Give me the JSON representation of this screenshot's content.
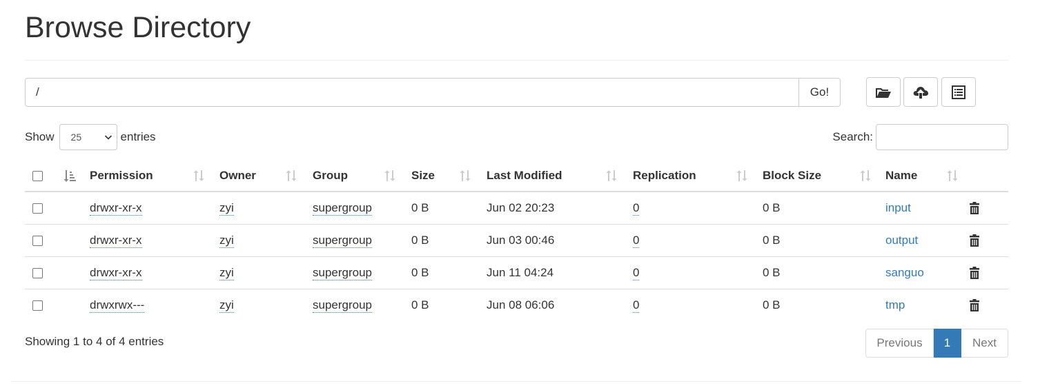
{
  "page": {
    "title": "Browse Directory"
  },
  "path_bar": {
    "value": "/",
    "go_label": "Go!"
  },
  "toolbar": {
    "buttons": [
      {
        "name": "create-directory",
        "icon": "folder-open-icon"
      },
      {
        "name": "upload",
        "icon": "cloud-upload-icon"
      },
      {
        "name": "cut-paste",
        "icon": "list-alt-icon"
      }
    ]
  },
  "length_control": {
    "show_label": "Show",
    "selected": "25",
    "entries_label": "entries"
  },
  "search": {
    "label": "Search:",
    "value": ""
  },
  "table": {
    "columns": [
      "Permission",
      "Owner",
      "Group",
      "Size",
      "Last Modified",
      "Replication",
      "Block Size",
      "Name"
    ],
    "rows": [
      {
        "permission": "drwxr-xr-x",
        "owner": "zyi",
        "group": "supergroup",
        "size": "0 B",
        "modified": "Jun 02 20:23",
        "replication": "0",
        "block_size": "0 B",
        "name": "input"
      },
      {
        "permission": "drwxr-xr-x",
        "owner": "zyi",
        "group": "supergroup",
        "size": "0 B",
        "modified": "Jun 03 00:46",
        "replication": "0",
        "block_size": "0 B",
        "name": "output"
      },
      {
        "permission": "drwxr-xr-x",
        "owner": "zyi",
        "group": "supergroup",
        "size": "0 B",
        "modified": "Jun 11 04:24",
        "replication": "0",
        "block_size": "0 B",
        "name": "sanguo"
      },
      {
        "permission": "drwxrwx---",
        "owner": "zyi",
        "group": "supergroup",
        "size": "0 B",
        "modified": "Jun 08 06:06",
        "replication": "0",
        "block_size": "0 B",
        "name": "tmp"
      }
    ]
  },
  "footer": {
    "info": "Showing 1 to 4 of 4 entries"
  },
  "pagination": {
    "previous": "Previous",
    "current": "1",
    "next": "Next"
  },
  "colors": {
    "link": "#337ab7",
    "active_page": "#337ab7",
    "border": "#dddddd",
    "sort_icon": "#cccccc"
  }
}
